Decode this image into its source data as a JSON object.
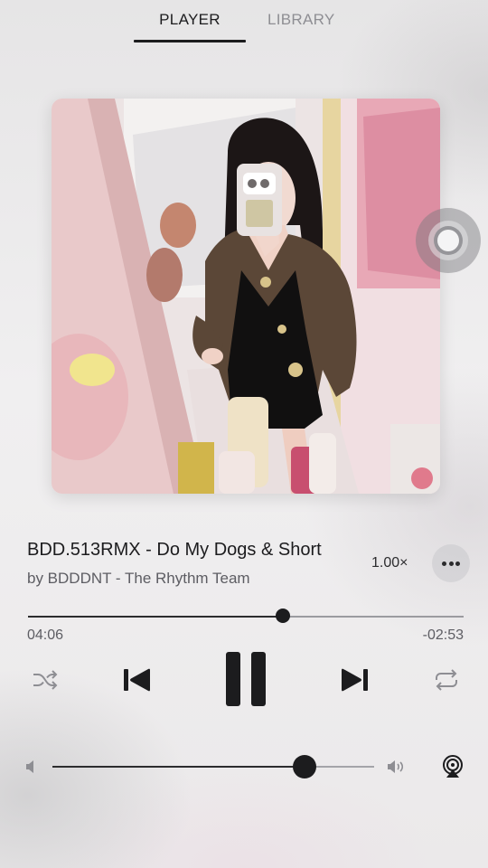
{
  "tabs": [
    {
      "label": "PLAYER",
      "active": true
    },
    {
      "label": "LIBRARY",
      "active": false
    }
  ],
  "track": {
    "title": "BDD.513RMX - Do My Dogs & Short",
    "artist_line": "by BDDDNT - The Rhythm Team",
    "artwork_icon": "album-artwork-photo"
  },
  "playback": {
    "speed_label": "1.00×",
    "elapsed": "04:06",
    "remaining": "-02:53",
    "progress_fraction": 0.586,
    "state": "playing"
  },
  "volume": {
    "level_fraction": 0.785
  },
  "icons": {
    "more": "more-icon",
    "shuffle": "shuffle-icon",
    "previous": "previous-track-icon",
    "pause": "pause-icon",
    "next": "next-track-icon",
    "repeat": "repeat-icon",
    "volume_low": "volume-low-icon",
    "volume_high": "volume-high-icon",
    "airplay": "airplay-icon",
    "assistive_touch": "assistive-touch-icon"
  },
  "colors": {
    "primary_text": "#1c1c1e",
    "secondary_text": "#5d5d63",
    "inactive_tab": "#8e8e93"
  }
}
